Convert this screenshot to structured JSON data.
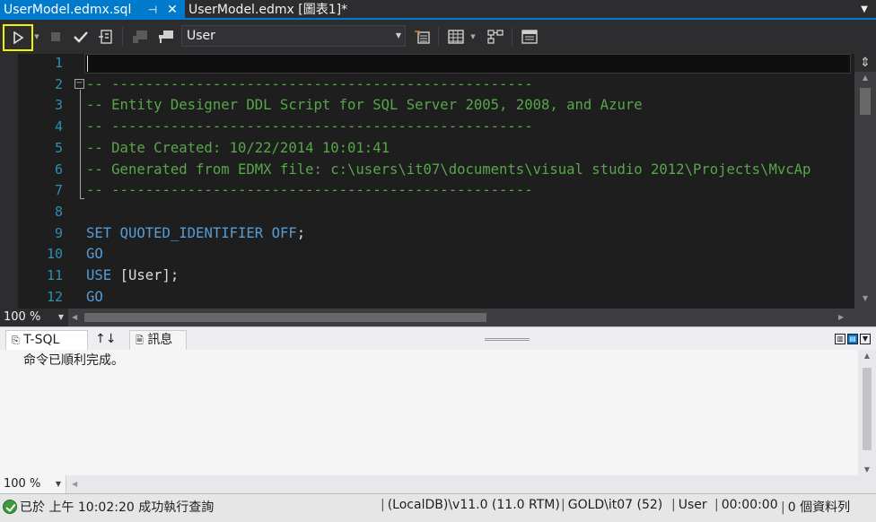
{
  "tabs": [
    {
      "label": "UserModel.edmx.sql",
      "active": true
    },
    {
      "label": "UserModel.edmx [圖表1]*",
      "active": false
    }
  ],
  "toolbar": {
    "database": "User",
    "icons": [
      "execute-icon",
      "dropdown-icon",
      "stop-icon",
      "parse-check-icon",
      "display-plan-icon",
      "query-options-icon",
      "change-connection-icon",
      "designer-icon",
      "results-grid-icon",
      "plan-icon",
      "results-pane-icon"
    ]
  },
  "editor": {
    "lines": [
      {
        "n": "1",
        "segments": []
      },
      {
        "n": "2",
        "segments": [
          {
            "t": "-- --------------------------------------------------",
            "c": "comment"
          }
        ]
      },
      {
        "n": "3",
        "segments": [
          {
            "t": "-- Entity Designer DDL Script for SQL Server 2005, 2008, and Azure",
            "c": "comment"
          }
        ]
      },
      {
        "n": "4",
        "segments": [
          {
            "t": "-- --------------------------------------------------",
            "c": "comment"
          }
        ]
      },
      {
        "n": "5",
        "segments": [
          {
            "t": "-- Date Created: 10/22/2014 10:01:41",
            "c": "comment"
          }
        ]
      },
      {
        "n": "6",
        "segments": [
          {
            "t": "-- Generated from EDMX file: c:\\users\\it07\\documents\\visual studio 2012\\Projects\\MvcAp",
            "c": "comment"
          }
        ]
      },
      {
        "n": "7",
        "segments": [
          {
            "t": "-- --------------------------------------------------",
            "c": "comment"
          }
        ]
      },
      {
        "n": "8",
        "segments": []
      },
      {
        "n": "9",
        "segments": [
          {
            "t": "SET ",
            "c": "kw"
          },
          {
            "t": "QUOTED_IDENTIFIER ",
            "c": "kw"
          },
          {
            "t": "OFF",
            "c": "kw"
          },
          {
            "t": ";",
            "c": "plain"
          }
        ]
      },
      {
        "n": "10",
        "segments": [
          {
            "t": "GO",
            "c": "kw"
          }
        ]
      },
      {
        "n": "11",
        "segments": [
          {
            "t": "USE ",
            "c": "kw"
          },
          {
            "t": "[User]",
            "c": "plain"
          },
          {
            "t": ";",
            "c": "plain"
          }
        ]
      },
      {
        "n": "12",
        "segments": [
          {
            "t": "GO",
            "c": "kw"
          }
        ]
      }
    ],
    "zoom": "100 %"
  },
  "results": {
    "tabs": [
      {
        "label": "T-SQL"
      },
      {
        "label": "↑↓"
      },
      {
        "label": "訊息"
      }
    ],
    "message": "命令已順利完成。",
    "zoom": "100 %"
  },
  "status": {
    "text": "已於 上午 10:02:20 成功執行查詢",
    "server": "(LocalDB)\\v11.0 (11.0 RTM)",
    "user": "GOLD\\it07 (52)",
    "database": "User",
    "elapsed": "00:00:00",
    "rows": "0 個資料列"
  }
}
